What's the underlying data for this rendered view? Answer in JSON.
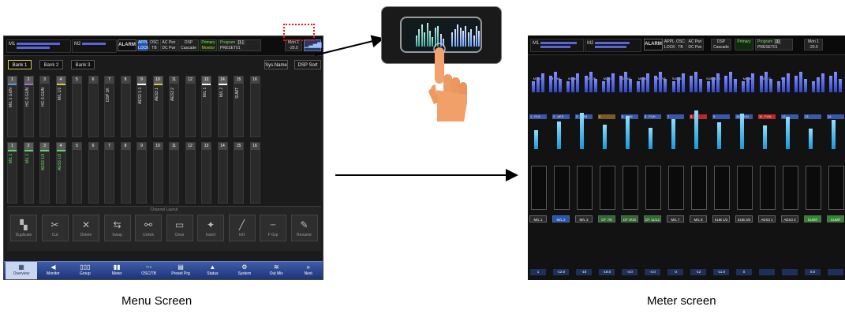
{
  "menu_screen": {
    "top": {
      "m1": "M1",
      "m2": "M2",
      "alarm": "ALARM",
      "appl": "APPL",
      "osc": "OSC",
      "lock": "LOCK",
      "tb": "TB",
      "ac_pwr": "AC Pwr",
      "dc_pwr": "DC Pwr",
      "sync": "Sync",
      "dsp": "DSP",
      "cascade": "Cascade",
      "primary": "Primary",
      "monitor": "Monitor",
      "program": "Program",
      "program_no": "[1.]",
      "preset": "PRESET01",
      "meter_value": "-20.0",
      "meter_label": "Mon 1"
    },
    "banks": [
      "Bank 1",
      "Bank 2",
      "Bank 3"
    ],
    "sys_name": "Sys.Name",
    "dsp_sort": "DSP Sort",
    "row1": [
      {
        "num": "1",
        "name": "M/L 1 GUN",
        "hl": "#5a9bd8"
      },
      {
        "num": "2",
        "name": "HC-3.GUN",
        "hl": "#b06ad8"
      },
      {
        "num": "3",
        "name": "HC-3.GUN",
        "hl": ""
      },
      {
        "num": "4",
        "name": "M/L 1/2",
        "hl": "#d8c84a"
      },
      {
        "num": "5",
        "name": "",
        "hl": ""
      },
      {
        "num": "6",
        "name": "",
        "hl": ""
      },
      {
        "num": "7",
        "name": "DSP 1K",
        "hl": ""
      },
      {
        "num": "8",
        "name": "",
        "hl": ""
      },
      {
        "num": "9",
        "name": "AES3 1-1",
        "hl": "#ffffff"
      },
      {
        "num": "10",
        "name": "AES3 1",
        "hl": "#d8c84a"
      },
      {
        "num": "11",
        "name": "AES3 2",
        "hl": ""
      },
      {
        "num": "12",
        "name": "",
        "hl": ""
      },
      {
        "num": "13",
        "name": "M/L 1",
        "hl": "#ffffff"
      },
      {
        "num": "14",
        "name": "M/L 2",
        "hl": "#ffffff"
      },
      {
        "num": "15",
        "name": "SUMT",
        "hl": ""
      },
      {
        "num": "16",
        "name": "",
        "hl": ""
      }
    ],
    "row2": [
      {
        "num": "1",
        "name": "M/L 1",
        "hl": "#5ad868",
        "green": true
      },
      {
        "num": "2",
        "name": "M/L 1",
        "hl": "#5ad868",
        "green": true
      },
      {
        "num": "3",
        "name": "AES3 1/3",
        "hl": "#5ad868",
        "green": true
      },
      {
        "num": "4",
        "name": "AES3 1/3",
        "hl": "#5ad868",
        "green": true
      },
      {
        "num": "5",
        "name": "",
        "hl": ""
      },
      {
        "num": "6",
        "name": "",
        "hl": ""
      },
      {
        "num": "7",
        "name": "",
        "hl": ""
      },
      {
        "num": "8",
        "name": "",
        "hl": ""
      },
      {
        "num": "9",
        "name": "",
        "hl": ""
      },
      {
        "num": "10",
        "name": "",
        "hl": ""
      },
      {
        "num": "11",
        "name": "",
        "hl": ""
      },
      {
        "num": "12",
        "name": "",
        "hl": ""
      },
      {
        "num": "13",
        "name": "",
        "hl": ""
      },
      {
        "num": "14",
        "name": "",
        "hl": ""
      },
      {
        "num": "15",
        "name": "",
        "hl": ""
      },
      {
        "num": "16",
        "name": "",
        "hl": ""
      }
    ],
    "channel_layout_title": "Channel Layout",
    "layout_buttons": [
      {
        "label": "Duplicate",
        "icon": "duplicate-icon",
        "glyph": "▚"
      },
      {
        "label": "Cut",
        "icon": "scissors-icon",
        "glyph": "✂"
      },
      {
        "label": "Delete",
        "icon": "delete-icon",
        "glyph": "✕"
      },
      {
        "label": "Swap",
        "icon": "swap-icon",
        "glyph": "⇆"
      },
      {
        "label": "Unlink",
        "icon": "unlink-icon",
        "glyph": "⚯"
      },
      {
        "label": "Clear",
        "icon": "clear-icon",
        "glyph": "▭"
      },
      {
        "label": "Insert",
        "icon": "insert-icon",
        "glyph": "✦"
      },
      {
        "label": "InIt",
        "icon": "init-icon",
        "glyph": "╱"
      },
      {
        "label": "F Grp",
        "icon": "fgroup-icon",
        "glyph": "┄"
      },
      {
        "label": "Rename",
        "icon": "rename-icon",
        "glyph": "✎"
      }
    ],
    "menubar": [
      {
        "label": "Overview",
        "glyph": "▦",
        "icon": "overview-icon",
        "active": true
      },
      {
        "label": "Monitor",
        "glyph": "◀",
        "icon": "speaker-icon"
      },
      {
        "label": "Group",
        "glyph": "▯▯▯",
        "icon": "group-icon"
      },
      {
        "label": "Meter",
        "glyph": "▮▮",
        "icon": "meter-icon"
      },
      {
        "label": "OSC/TB",
        "glyph": "~◦",
        "icon": "osc-icon"
      },
      {
        "label": "Preset Prg",
        "glyph": "▤",
        "icon": "preset-icon"
      },
      {
        "label": "Status",
        "glyph": "▲",
        "icon": "status-icon"
      },
      {
        "label": "System",
        "glyph": "⚙",
        "icon": "gear-icon"
      },
      {
        "label": "Out Mix",
        "glyph": "≋",
        "icon": "outmix-icon"
      },
      {
        "label": "Next",
        "glyph": "»",
        "icon": "next-icon"
      }
    ]
  },
  "meter_screen": {
    "labels": [
      "M1-1/2",
      "M1-3/4",
      "M1-5/6",
      "M1-7/8",
      "M2-1/2",
      "M2-3/4",
      "M2-5/6",
      "M2-7/8",
      "SUM 1-8",
      "",
      "SUM 9-16",
      "",
      "Monitor",
      "M1-1/2",
      "M1"
    ],
    "heads": [
      {
        "n": "1",
        "t": "PU1",
        "c": "#3a57a8"
      },
      {
        "n": "2",
        "t": "AES",
        "c": "#3a57a8"
      },
      {
        "n": "3",
        "t": "SUM",
        "c": "#3a57a8"
      },
      {
        "n": "4",
        "t": "",
        "c": "#7a5a2a"
      },
      {
        "n": "5",
        "t": "FUN",
        "c": "#3a57a8"
      },
      {
        "n": "6",
        "t": "FUN",
        "c": "#3a57a8"
      },
      {
        "n": "7",
        "t": "",
        "c": "#3a57a8"
      },
      {
        "n": "8",
        "t": "",
        "c": "#b82a2a"
      },
      {
        "n": "9",
        "t": "",
        "c": "#3a57a8"
      },
      {
        "n": "10",
        "t": "FUN",
        "c": "#3a57a8"
      },
      {
        "n": "11",
        "t": "FUN",
        "c": "#b82a2a"
      },
      {
        "n": "12",
        "t": "",
        "c": "#3a57a8"
      },
      {
        "n": "13",
        "t": "",
        "c": "#3a57a8"
      },
      {
        "n": "14",
        "t": "",
        "c": "#3a57a8"
      }
    ],
    "pills": [
      {
        "t": "M/L 1",
        "c": "#2a2a2a"
      },
      {
        "t": "M/L 2",
        "c": "#1e55c0"
      },
      {
        "t": "M/L 3",
        "c": "#2a2a2a"
      },
      {
        "t": "DT 7/8",
        "c": "#2a6a2a"
      },
      {
        "t": "DT 9/10",
        "c": "#2a6a2a"
      },
      {
        "t": "DT 11/12",
        "c": "#2a6a2a"
      },
      {
        "t": "M/L 7",
        "c": "#2a2a2a"
      },
      {
        "t": "M/L 8",
        "c": "#2a2a2a"
      },
      {
        "t": "SUB 1/2",
        "c": "#2a2a2a"
      },
      {
        "t": "SUB 3/4",
        "c": "#2a2a2a"
      },
      {
        "t": "AES3 1",
        "c": "#2a2a2a"
      },
      {
        "t": "AES3 2",
        "c": "#2a2a2a"
      },
      {
        "t": "SUMT",
        "c": "#2a8a2a"
      },
      {
        "t": "SUMF",
        "c": "#2a8a2a"
      }
    ],
    "bottom_values": [
      "1",
      "-12.0",
      "-18",
      "-18.0",
      "-4.0",
      "-4.0",
      "-3",
      "-12",
      "-11.0",
      "0",
      "",
      "",
      "0.0",
      ""
    ],
    "top": {
      "m1": "M1",
      "m2": "M2",
      "alarm": "ALARM",
      "appl": "APPL",
      "osc": "OSC",
      "lock": "LOCK",
      "tb": "TB",
      "ac_pwr": "AC Pwr",
      "dc_pwr": "DC Pwr",
      "sync": "Sync",
      "dsp": "DSP",
      "cascade": "Cascade",
      "primary": "Primary",
      "program": "Program",
      "program_no": "[1]",
      "preset": "PRESET01",
      "meter_value": "-20.0",
      "meter_label": "Mon 1"
    }
  },
  "captions": {
    "menu": "Menu Screen",
    "meter": "Meter screen"
  }
}
